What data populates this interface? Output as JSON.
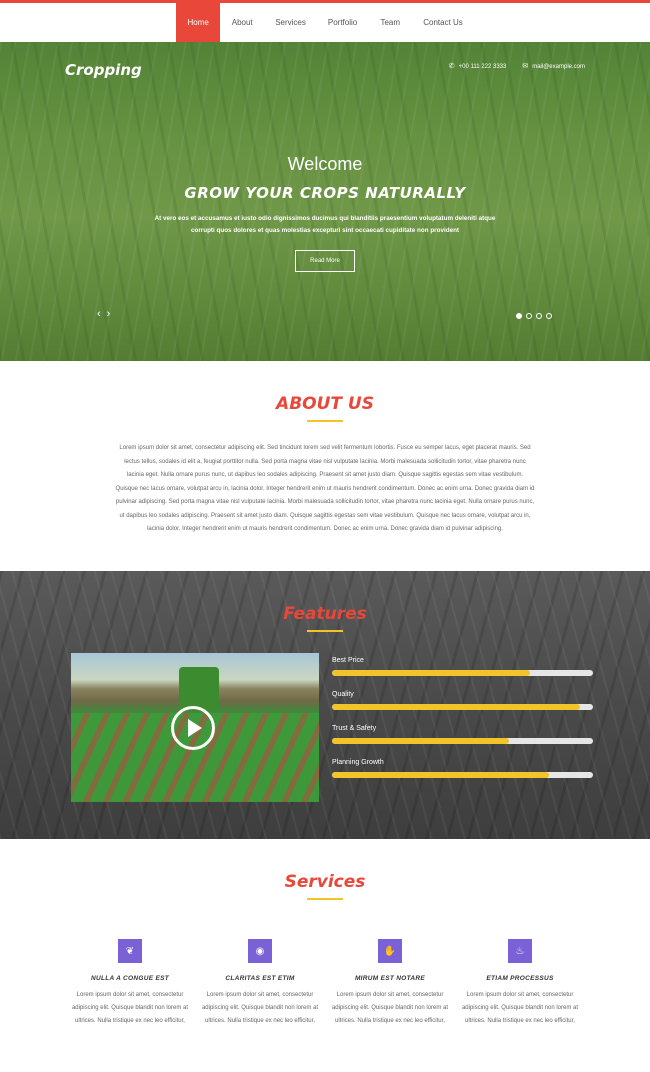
{
  "nav": {
    "items": [
      "Home",
      "About",
      "Services",
      "Portfolio",
      "Team",
      "Contact Us"
    ],
    "active": "Home"
  },
  "hero": {
    "logo": "Cropping",
    "phone": "+00 111 222 3333",
    "email": "mail@example.com",
    "welcome": "Welcome",
    "tagline": "GROW YOUR CROPS NATURALLY",
    "blurb": "At vero eos et accusamus et iusto odio dignissimos ducimus qui blanditiis praesentium voluptatum deleniti atque corrupti quos dolores et quas molestias excepturi sint occaecati cupiditate non provident",
    "read_more": "Read More",
    "arrow_prev": "‹",
    "arrow_next": "›",
    "slide_count": 4,
    "active_slide": 1
  },
  "about": {
    "title": "ABOUT US",
    "text": "Lorem ipsum dolor sit amet, consectetur adipiscing elit. Sed tincidunt lorem sed velit fermentum lobortis. Fusce eu semper lacus, eget placerat mauris. Sed lectus tellus, sodales id elit a, feugiat porttitor nulla. Sed porta magna vitae nisl vulputate lacinia. Morbi malesuada sollicitudin tortor, vitae pharetra nunc lacinia eget. Nulla ornare purus nunc, ut dapibus leo sodales adipiscing. Praesent sit amet justo diam. Quisque sagittis egestas sem vitae vestibulum. Quisque nec lacus ornare, volutpat arcu in, lacinia dolor. Integer hendrerit enim ut mauris hendrerit condimentum. Donec ac enim urna. Donec gravida diam id pulvinar adipiscing. Sed porta magna vitae nisl vulputate lacinia. Morbi malesuada sollicitudin tortor, vitae pharetra nunc lacinia eget. Nulla ornare purus nunc, ut dapibus leo sodales adipiscing. Praesent sit amet justo diam. Quisque sagittis egestas sem vitae vestibulum. Quisque nec lacus ornare, volutpat arcu in, lacinia dolor. Integer hendrerit enim ut mauris hendrerit condimentum. Donec ac enim urna. Donec gravida diam id pulvinar adipiscing."
  },
  "features": {
    "title": "Features",
    "bars": [
      {
        "label": "Best Price",
        "percent": 76
      },
      {
        "label": "Quality",
        "percent": 95
      },
      {
        "label": "Trust & Safety",
        "percent": 68
      },
      {
        "label": "Planning Growth",
        "percent": 83
      }
    ]
  },
  "services": {
    "title": "Services",
    "items": [
      {
        "icon": "leaf-icon",
        "glyph": "❦",
        "title": "NULLA A CONGUE EST",
        "text": "Lorem ipsum dolor sit amet, consectetur adipiscing elit. Quisque blandit non lorem at ultrices. Nulla tristique ex nec leo efficitur,"
      },
      {
        "icon": "globe-icon",
        "glyph": "◉",
        "title": "CLARITAS EST ETIM",
        "text": "Lorem ipsum dolor sit amet, consectetur adipiscing elit. Quisque blandit non lorem at ultrices. Nulla tristique ex nec leo efficitur,"
      },
      {
        "icon": "thumbs-up-icon",
        "glyph": "✋",
        "title": "MIRUM EST NOTARE",
        "text": "Lorem ipsum dolor sit amet, consectetur adipiscing elit. Quisque blandit non lorem at ultrices. Nulla tristique ex nec leo efficitur,"
      },
      {
        "icon": "drop-icon",
        "glyph": "♨",
        "title": "ETIAM PROCESSUS",
        "text": "Lorem ipsum dolor sit amet, consectetur adipiscing elit. Quisque blandit non lorem at ultrices. Nulla tristique ex nec leo efficitur,"
      }
    ]
  },
  "colors": {
    "accent": "#e8473a",
    "highlight": "#f3c42a",
    "icon_bg": "#7a61d6"
  }
}
